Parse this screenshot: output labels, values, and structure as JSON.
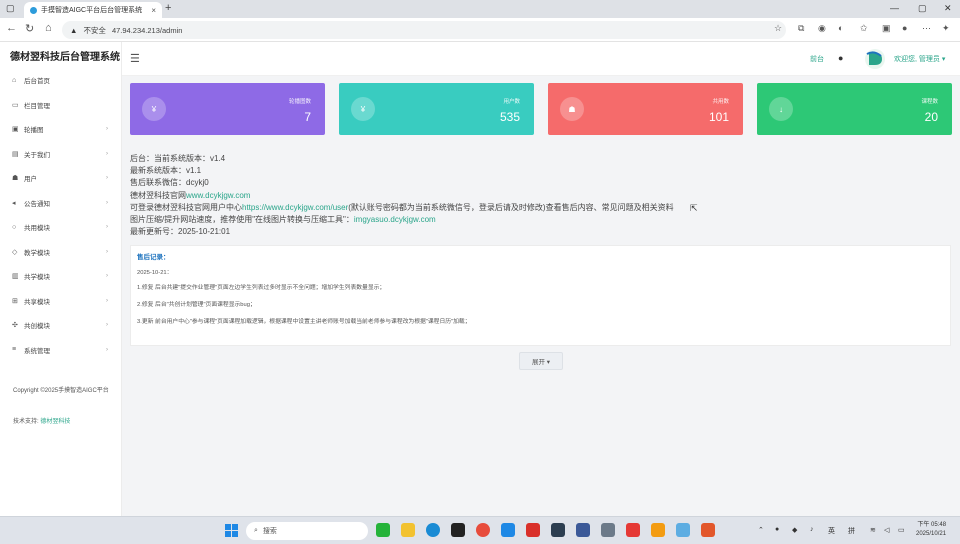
{
  "browser": {
    "tab_title": "手摸智造AIGC平台后台管理系统",
    "security_label": "不安全",
    "url": "47.94.234.213/admin"
  },
  "sidebar": {
    "brand": "德材翌科技后台管理系统",
    "items": [
      {
        "label": "后台首页",
        "icon": "home-icon",
        "has_arrow": false
      },
      {
        "label": "栏目管理",
        "icon": "monitor-icon",
        "has_arrow": false
      },
      {
        "label": "轮播图",
        "icon": "image-icon",
        "has_arrow": true
      },
      {
        "label": "关于我们",
        "icon": "info-icon",
        "has_arrow": true
      },
      {
        "label": "用户",
        "icon": "users-icon",
        "has_arrow": true
      },
      {
        "label": "公告通知",
        "icon": "speaker-icon",
        "has_arrow": true
      },
      {
        "label": "共用模块",
        "icon": "circle-icon",
        "has_arrow": true
      },
      {
        "label": "教学模块",
        "icon": "diamond-icon",
        "has_arrow": true
      },
      {
        "label": "共学模块",
        "icon": "book-icon",
        "has_arrow": true
      },
      {
        "label": "共享模块",
        "icon": "grid-icon",
        "has_arrow": true
      },
      {
        "label": "共创模块",
        "icon": "puzzle-icon",
        "has_arrow": true
      },
      {
        "label": "系统管理",
        "icon": "list-icon",
        "has_arrow": true
      }
    ],
    "copyright": "Copyright ©2025手摸智造AIGC平台",
    "support_label": "技术支持:",
    "support_link": "德材翌科技"
  },
  "topbar": {
    "home_link": "前台",
    "welcome": "欢迎您, 管理员 ▾"
  },
  "cards": [
    {
      "label": "轮播图数",
      "value": "7",
      "color": "#8e6ae6",
      "icon": "¥"
    },
    {
      "label": "用户数",
      "value": "535",
      "color": "#39ccc0",
      "icon": "¥"
    },
    {
      "label": "共用数",
      "value": "101",
      "color": "#f56b6b",
      "icon": "user"
    },
    {
      "label": "课程数",
      "value": "20",
      "color": "#2dc876",
      "icon": "↓"
    }
  ],
  "info": {
    "backend_version": "后台：当前系统版本：v1.4",
    "latest_version": "最新系统版本：v1.1",
    "wechat": "售后联系微信：dcykj0",
    "site_prefix": "德材翌科技官网",
    "site_url": "www.dcykjgw.com",
    "login_prefix": "可登录德材翌科技官网用户中心",
    "login_url": "https://www.dcykjgw.com/user",
    "login_suffix": "(默认账号密码都为当前系统微信号，登录后请及时修改)查看售后内容、常见问题及相关资料",
    "compress_prefix": "图片压缩/提升网站速度，推荐使用\"在线图片转换与压缩工具\"：",
    "compress_url": "imgyasuo.dcykjgw.com",
    "update_no": "最新更新号：2025-10-21:01"
  },
  "panel": {
    "title": "售后记录：",
    "lines": [
      "2025-10-21：",
      "1.修复 后台共建\"提交作业管理\"页面左边学生列表过多时显示不全问题；增加学生列表数量显示；",
      "2.修复 后台\"共创计划管理\"页面课程显示bug；",
      "3.更新 前台用户中心\"参与课程\"页面课程加载逻辑，根据课程中设置主讲老师账号加载当前老师参与课程改为根据\"课程日历\"加载；"
    ]
  },
  "expand_label": "展开 ▾",
  "taskbar": {
    "search_placeholder": "搜索",
    "tray_lang": "英",
    "tray_ime": "拼",
    "time": "下午 05:48",
    "date": "2025/10/21"
  }
}
